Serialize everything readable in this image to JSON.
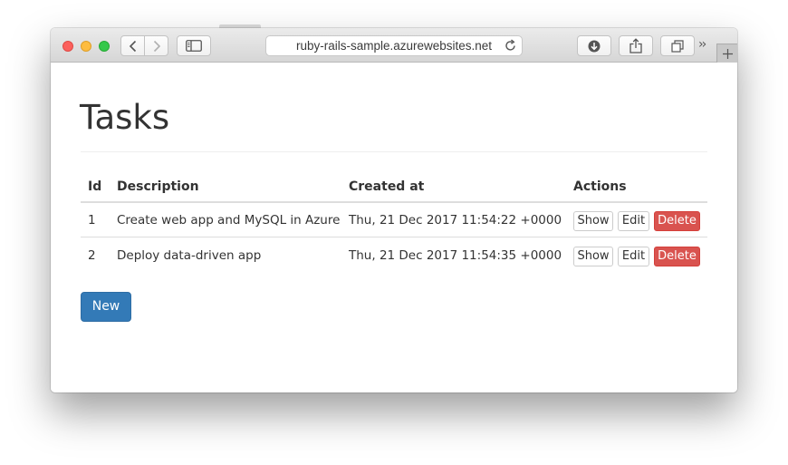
{
  "browser": {
    "url": "ruby-rails-sample.azurewebsites.net"
  },
  "page": {
    "title": "Tasks",
    "table": {
      "headers": [
        "Id",
        "Description",
        "Created at",
        "Actions"
      ],
      "rows": [
        {
          "id": "1",
          "description": "Create web app and MySQL in Azure",
          "created_at": "Thu, 21 Dec 2017 11:54:22 +0000"
        },
        {
          "id": "2",
          "description": "Deploy data-driven app",
          "created_at": "Thu, 21 Dec 2017 11:54:35 +0000"
        }
      ],
      "actions": {
        "show": "Show",
        "edit": "Edit",
        "delete": "Delete"
      }
    },
    "new_button": "New"
  },
  "colors": {
    "primary": "#337ab7",
    "danger": "#d9534f"
  },
  "icons": [
    "back-icon",
    "forward-icon",
    "sidebar-icon",
    "reload-icon",
    "download-icon",
    "share-icon",
    "tabs-icon",
    "more-chevrons-icon",
    "plus-icon"
  ]
}
